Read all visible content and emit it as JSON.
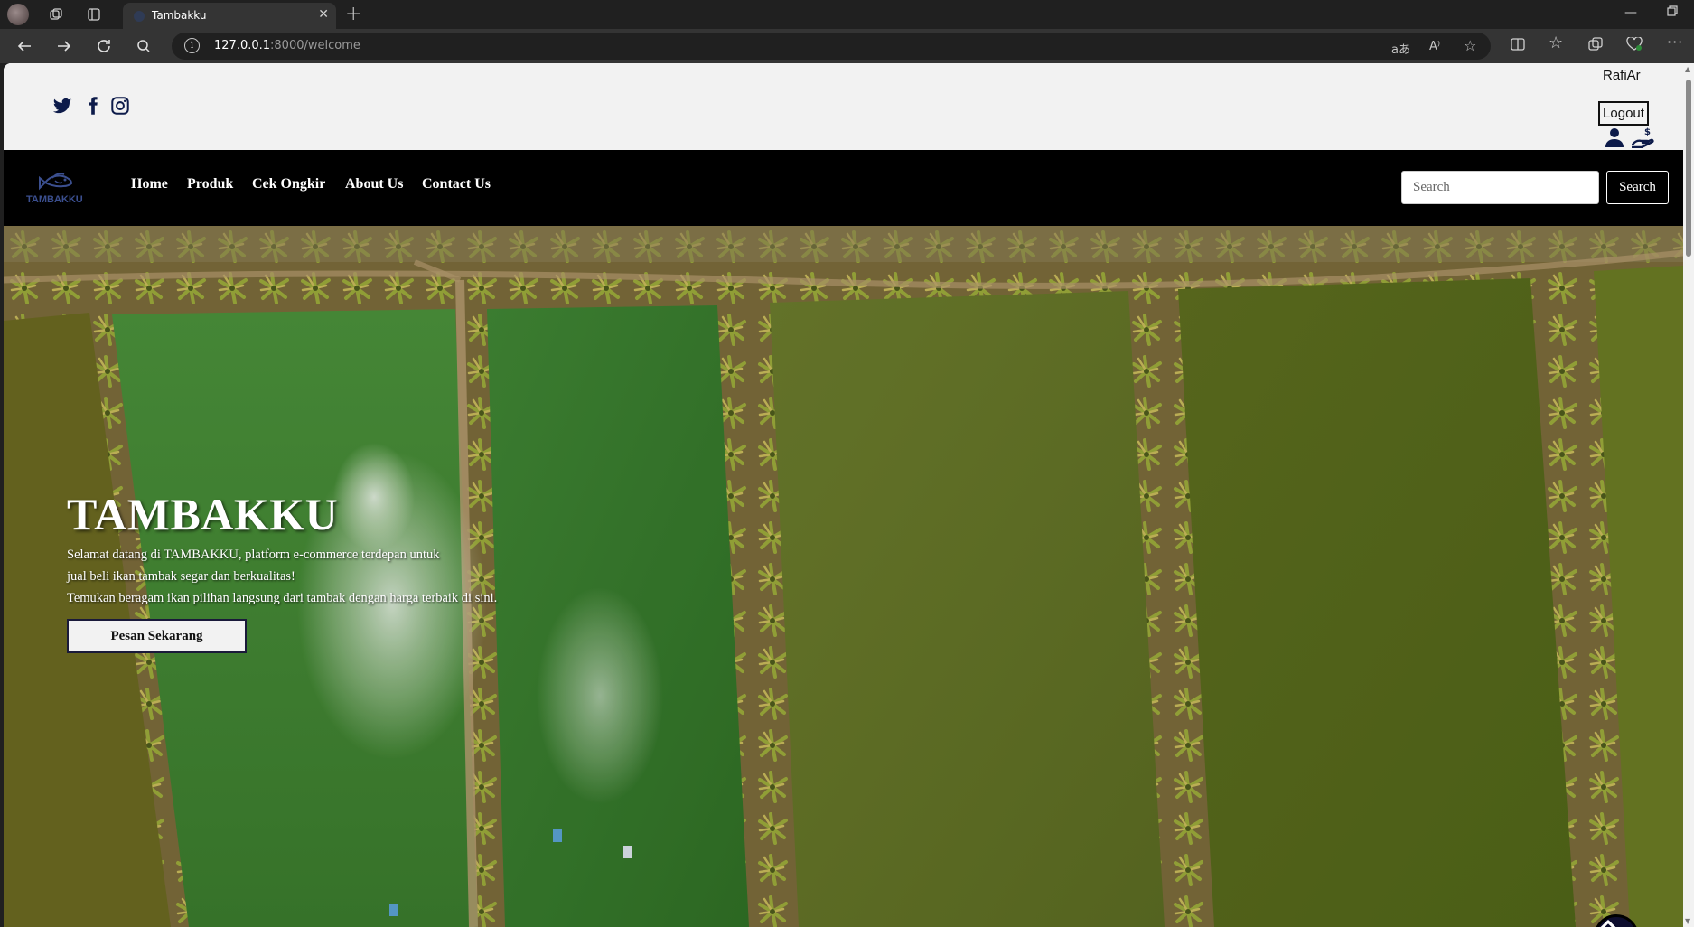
{
  "browser": {
    "tab_title": "Tambakku",
    "address_host": "127.0.0.1",
    "address_rest": ":8000/welcome",
    "icons": [
      "back-icon",
      "forward-icon",
      "refresh-icon",
      "search-icon",
      "info-icon",
      "translate-icon",
      "read-aloud-icon",
      "favorite-icon",
      "split-screen-icon",
      "favorites-icon",
      "collections-icon",
      "health-icon",
      "more-icon"
    ]
  },
  "topbar": {
    "social_icons": [
      "twitter-icon",
      "facebook-icon",
      "instagram-icon"
    ],
    "user_name": "RafiAr",
    "logout_label": "Logout"
  },
  "navbar": {
    "logo_text": "TAMBAKKU",
    "links": [
      "Home",
      "Produk",
      "Cek Ongkir",
      "About Us",
      "Contact Us"
    ],
    "search_placeholder": "Search",
    "search_button": "Search"
  },
  "hero": {
    "title": "TAMBAKKU",
    "line1": "Selamat datang di TAMBAKKU, platform e-commerce terdepan untuk",
    "line2": "jual beli ikan tambak segar dan berkualitas!",
    "line3": "Temukan beragam ikan pilihan langsung dari tambak dengan harga terbaik di sini.",
    "cta_label": "Pesan Sekarang"
  },
  "colors": {
    "navbar_bg": "#000000",
    "topbar_bg": "#f2f2f2",
    "pond_green": "#3d7a2c",
    "pond_olive": "#5c7220",
    "to_top_bg": "#0d0d2e"
  }
}
